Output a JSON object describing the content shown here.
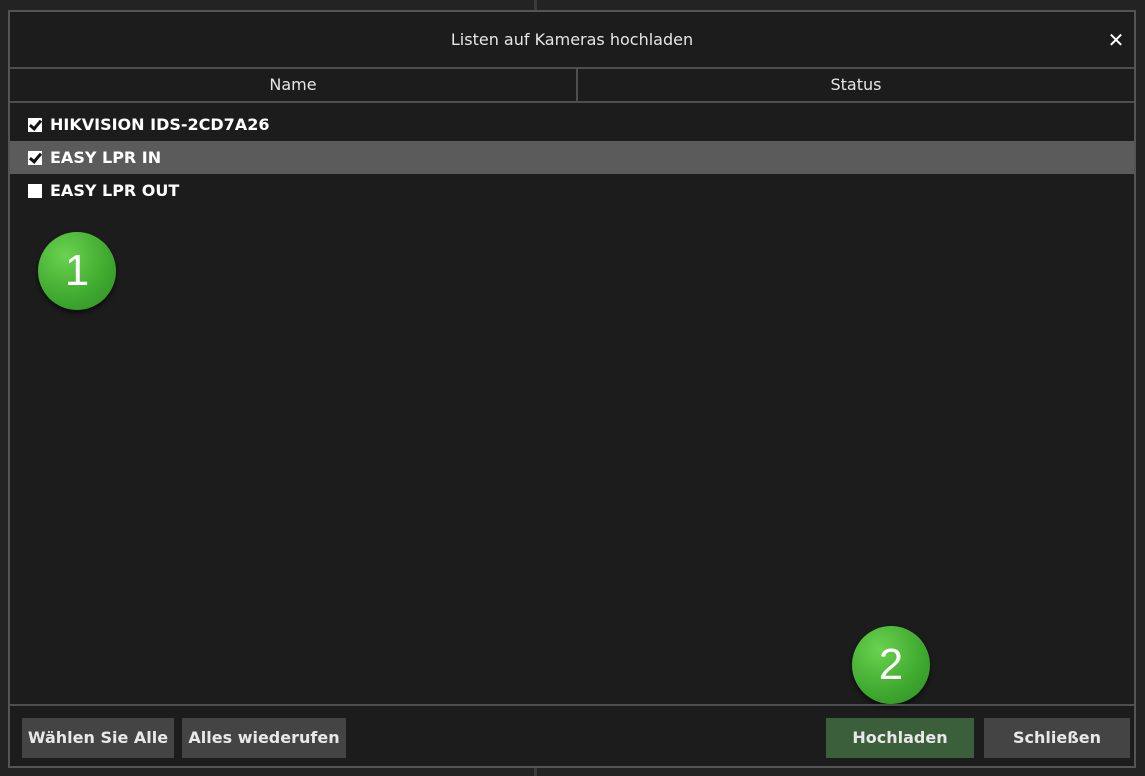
{
  "dialog": {
    "title": "Listen auf Kameras hochladen",
    "close_symbol": "✕"
  },
  "table": {
    "columns": [
      "Name",
      "Status"
    ],
    "rows": [
      {
        "name": "HIKVISION IDS-2CD7A26",
        "checked": true,
        "selected": false,
        "status": ""
      },
      {
        "name": "EASY LPR IN",
        "checked": true,
        "selected": true,
        "status": ""
      },
      {
        "name": "EASY LPR OUT",
        "checked": false,
        "selected": false,
        "status": ""
      }
    ]
  },
  "annotations": {
    "step1": "1",
    "step2": "2",
    "color": "#3ea82f"
  },
  "footer": {
    "select_all_label": "Wählen Sie Alle",
    "recall_all_label": "Alles wiederufen",
    "upload_label": "Hochladen",
    "close_label": "Schließen"
  },
  "colors": {
    "dialog_bg": "#1c1c1c",
    "selected_row": "#5b5b5b",
    "upload_button": "#3b5e3b",
    "button": "#444444"
  }
}
